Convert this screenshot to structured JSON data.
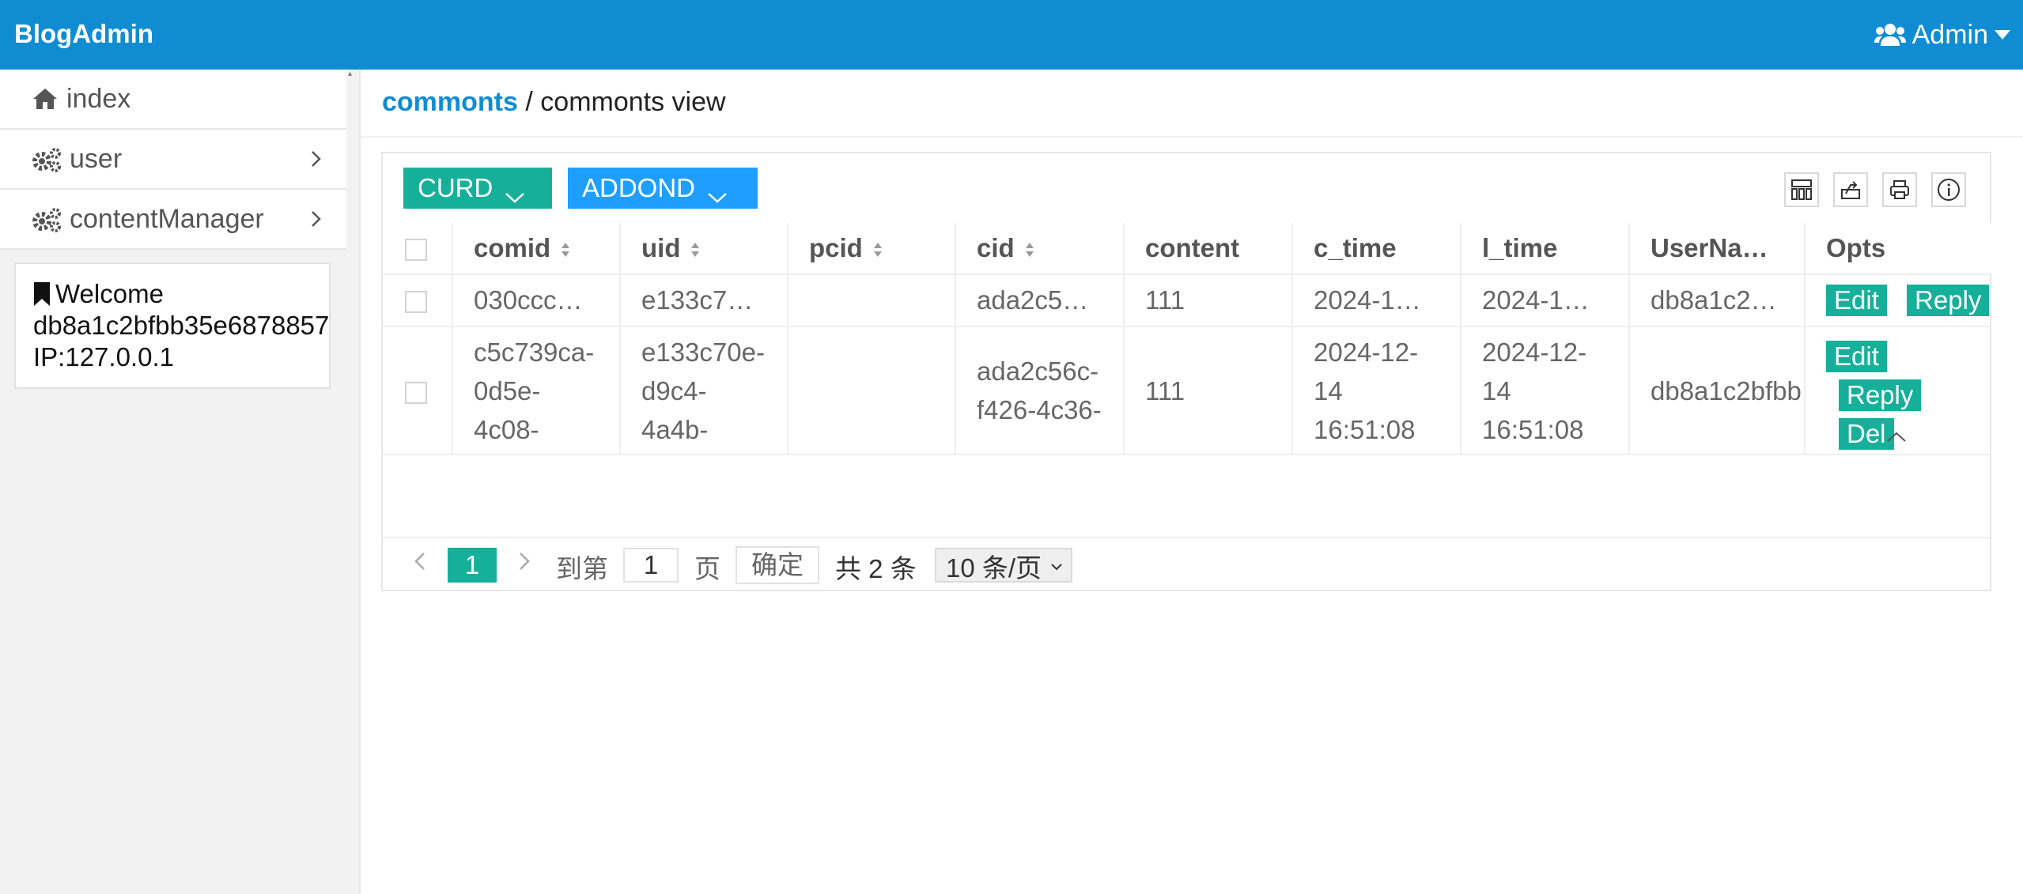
{
  "header": {
    "brand": "BlogAdmin",
    "user_label": "Admin"
  },
  "sidebar": {
    "items": [
      {
        "label": "index",
        "icon": "home-icon"
      },
      {
        "label": "user",
        "icon": "gears-icon"
      },
      {
        "label": "contentManager",
        "icon": "gears-icon"
      }
    ],
    "welcome": {
      "line1": "Welcome",
      "line2": "db8a1c2bfbb35e6878857",
      "line3": "IP:127.0.0.1"
    }
  },
  "breadcrumb": {
    "root": "commonts",
    "separator": "/",
    "current": "commonts view"
  },
  "toolbar": {
    "curd_label": "CURD",
    "addond_label": "ADDOND"
  },
  "table": {
    "headers": {
      "comid": "comid",
      "uid": "uid",
      "pcid": "pcid",
      "cid": "cid",
      "content": "content",
      "c_time": "c_time",
      "l_time": "l_time",
      "username": "UserNa…",
      "opts": "Opts"
    },
    "rows": [
      {
        "comid": "030ccc…",
        "uid": "e133c7…",
        "pcid": "",
        "cid": "ada2c5…",
        "content": "111",
        "c_time": "2024-1…",
        "l_time": "2024-1…",
        "username": "db8a1c2…"
      },
      {
        "comid": "c5c739ca-0d5e-4c08-",
        "uid": "e133c70e-d9c4-4a4b-",
        "pcid": "",
        "cid": "ada2c56c-f426-4c36-",
        "content": "111",
        "c_time": "2024-12-14 16:51:08",
        "l_time": "2024-12-14 16:51:08",
        "username": "db8a1c2bfbb"
      }
    ],
    "actions": {
      "edit": "Edit",
      "reply": "Reply",
      "del": "Del"
    }
  },
  "pager": {
    "current": "1",
    "goto_label": "到第",
    "goto_value": "1",
    "page_label": "页",
    "confirm_label": "确定",
    "total_label": "共 2 条",
    "page_size": "10 条/页"
  },
  "colors": {
    "primary": "#108cd3",
    "accent": "#16b09a",
    "blue_btn": "#1e9fff"
  }
}
